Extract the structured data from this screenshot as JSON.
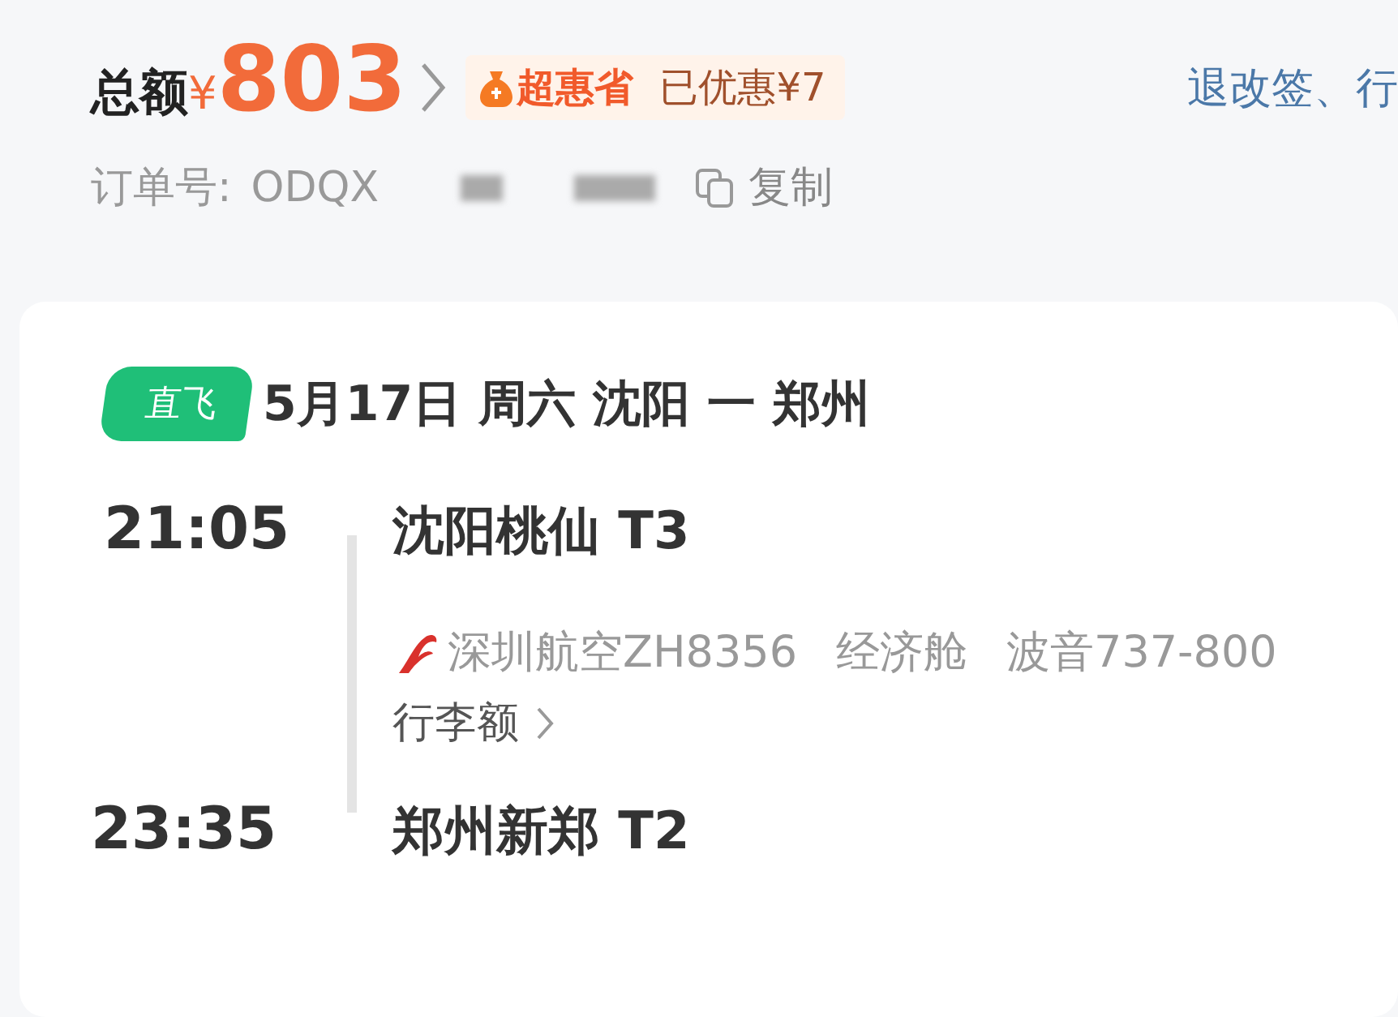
{
  "header": {
    "total_label": "总额",
    "currency": "¥",
    "amount": "803",
    "badge": "超惠省",
    "discount": "已优惠¥7",
    "link": "退改签、行"
  },
  "order": {
    "label": "订单号:",
    "number": "ODQX",
    "copy": "复制"
  },
  "flight": {
    "tag": "直飞",
    "title": "5月17日 周六 沈阳 一 郑州",
    "departure": {
      "time": "21:05",
      "airport": "沈阳桃仙 T3"
    },
    "details": [
      "深圳航空ZH8356",
      "经济舱",
      "波音737-800"
    ],
    "baggage": "行李额",
    "arrival": {
      "time": "23:35",
      "airport": "郑州新郑 T2"
    }
  }
}
